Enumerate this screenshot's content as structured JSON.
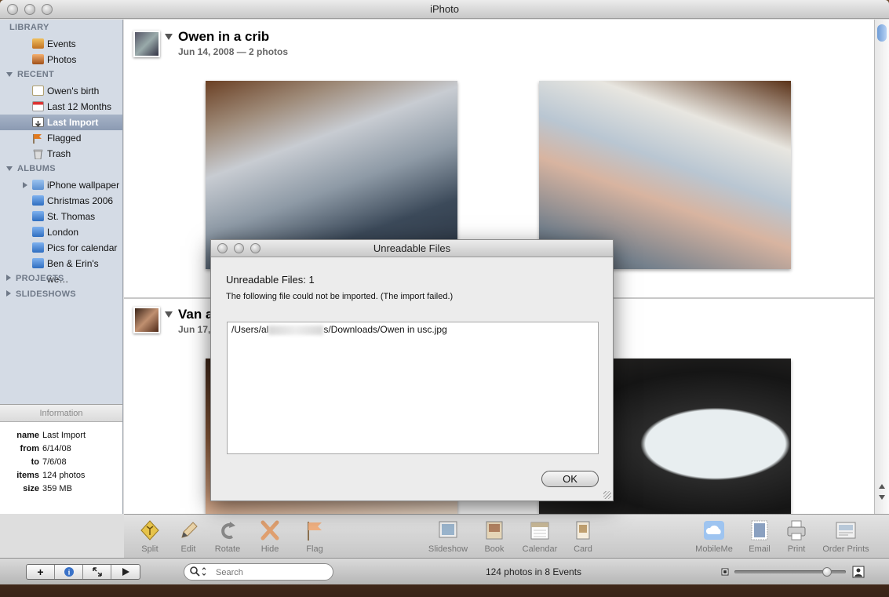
{
  "window": {
    "title": "iPhoto"
  },
  "sidebar": {
    "library": {
      "label": "LIBRARY",
      "items": [
        {
          "label": "Events",
          "icon": "events-icon"
        },
        {
          "label": "Photos",
          "icon": "photos-icon"
        }
      ]
    },
    "recent": {
      "label": "RECENT",
      "items": [
        {
          "label": "Owen's birth",
          "icon": "blank-album-icon"
        },
        {
          "label": "Last 12 Months",
          "icon": "calendar-icon"
        },
        {
          "label": "Last Import",
          "icon": "import-icon",
          "selected": true
        },
        {
          "label": "Flagged",
          "icon": "flag-icon"
        },
        {
          "label": "Trash",
          "icon": "trash-icon"
        }
      ]
    },
    "albums": {
      "label": "ALBUMS",
      "items": [
        {
          "label": "iPhone wallpaper",
          "icon": "folder-icon"
        },
        {
          "label": "Christmas 2006",
          "icon": "album-icon"
        },
        {
          "label": "St. Thomas",
          "icon": "album-icon"
        },
        {
          "label": "London",
          "icon": "album-icon"
        },
        {
          "label": "Pics for calendar",
          "icon": "album-icon"
        },
        {
          "label": "Ben & Erin's we…",
          "icon": "album-icon"
        }
      ]
    },
    "projects": {
      "label": "PROJECTS"
    },
    "slideshows": {
      "label": "SLIDESHOWS"
    }
  },
  "info": {
    "title": "Information",
    "rows": [
      {
        "key": "name",
        "value": "Last Import"
      },
      {
        "key": "from",
        "value": "6/14/08"
      },
      {
        "key": "to",
        "value": "7/6/08"
      },
      {
        "key": "items",
        "value": "124 photos"
      },
      {
        "key": "size",
        "value": "359 MB"
      }
    ]
  },
  "events": [
    {
      "title": "Owen in a crib",
      "subtitle": "Jun 14, 2008 — 2 photos"
    },
    {
      "title": "Van a",
      "subtitle": "Jun 17,"
    }
  ],
  "toolbar": {
    "left": [
      "Split",
      "Edit",
      "Rotate",
      "Hide",
      "Flag"
    ],
    "middle": [
      "Slideshow",
      "Book",
      "Calendar",
      "Card"
    ],
    "right": [
      "MobileMe",
      "Email",
      "Print",
      "Order Prints"
    ]
  },
  "bottombar": {
    "search_placeholder": "Search",
    "status": "124 photos in 8 Events"
  },
  "dialog": {
    "title": "Unreadable Files",
    "count_text": "Unreadable Files:  1",
    "message": "The following file could not be imported. (The import failed.)",
    "path_start": "/Users/al",
    "path_end": "s/Downloads/Owen in usc.jpg",
    "ok_label": "OK"
  },
  "colors": {
    "sidebar": "#d4dbe5",
    "selection": "#8b9ab2",
    "accent": "#6d9bd6"
  }
}
